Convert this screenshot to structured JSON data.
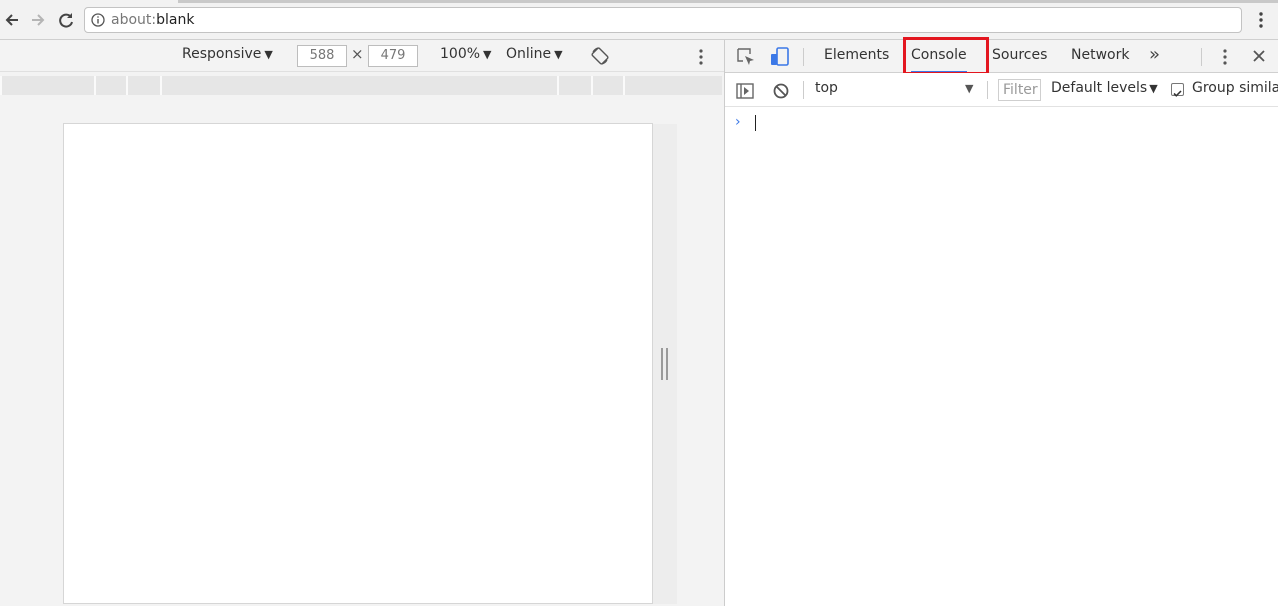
{
  "browser": {
    "url_scheme": "about:",
    "url_path": "blank",
    "icons": [
      "back-arrow-icon",
      "forward-arrow-icon",
      "reload-icon",
      "info-icon",
      "vertical-dots-icon"
    ]
  },
  "device_toolbar": {
    "device": "Responsive",
    "width": "588",
    "height": "479",
    "separator": "×",
    "zoom": "100%",
    "throttling": "Online",
    "dropdown_arrow": "▼"
  },
  "devtools": {
    "tabs": [
      {
        "label": "Elements",
        "active": false
      },
      {
        "label": "Console",
        "active": true
      },
      {
        "label": "Sources",
        "active": false
      },
      {
        "label": "Network",
        "active": false
      }
    ],
    "overflow_glyph": "»",
    "accent_color": "#3b78e7",
    "highlight_color": "#e3161f"
  },
  "console": {
    "context": "top",
    "filter_placeholder": "Filter",
    "levels": "Default levels",
    "group_similar_label": "Group similar",
    "group_similar_checked": true,
    "prompt_glyph": "›"
  }
}
